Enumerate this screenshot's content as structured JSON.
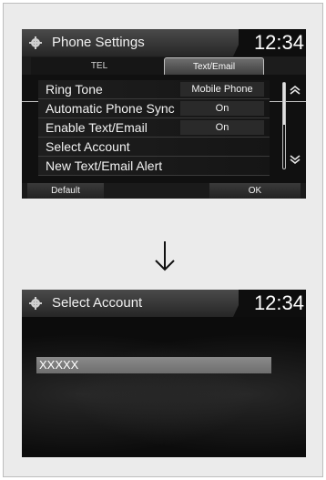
{
  "screen1": {
    "title": "Phone Settings",
    "clock": "12:34",
    "tabs": [
      {
        "label": "TEL",
        "active": false
      },
      {
        "label": "Text/Email",
        "active": true
      }
    ],
    "rows": [
      {
        "label": "Ring Tone",
        "value": "Mobile Phone"
      },
      {
        "label": "Automatic Phone Sync",
        "value": "On"
      },
      {
        "label": "Enable Text/Email",
        "value": "On"
      },
      {
        "label": "Select Account",
        "value": ""
      },
      {
        "label": "New Text/Email Alert",
        "value": ""
      }
    ],
    "buttons": {
      "default": "Default",
      "ok": "OK"
    }
  },
  "screen2": {
    "title": "Select Account",
    "clock": "12:34",
    "items": [
      {
        "label": "XXXXX"
      }
    ]
  },
  "icons": {
    "title_icon": "gear-icon",
    "scroll_up": "chevron-up-icon",
    "scroll_down": "chevron-down-icon",
    "transition": "down-arrow-icon"
  },
  "colors": {
    "screen_bg": "#101010",
    "highlight": "#7a7a7a",
    "frame_bg": "#ebebeb"
  }
}
